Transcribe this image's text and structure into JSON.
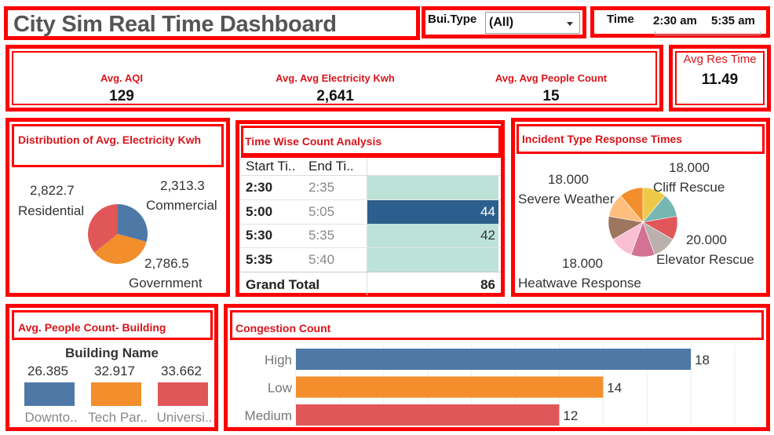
{
  "header": {
    "title": "City Sim Real Time Dashboard",
    "filter_label": "Bui.Type",
    "filter_value": "(All)",
    "time_label": "Time",
    "time_start": "2:30 am",
    "time_end": "5:35 am",
    "time_range_fraction": [
      0,
      1
    ]
  },
  "kpis": [
    {
      "label": "Avg. AQI",
      "value": "129"
    },
    {
      "label": "Avg. Avg Electricity Kwh",
      "value": "2,641"
    },
    {
      "label": "Avg. Avg People Count",
      "value": "15"
    }
  ],
  "res_time": {
    "label": "Avg Res Time",
    "value": "11.49"
  },
  "electricity": {
    "title": "Distribution of Avg. Electricity Kwh",
    "slices": [
      {
        "label": "Commercial",
        "value_text": "2,313.3",
        "value": 2313.3,
        "color": "#4e79a7"
      },
      {
        "label": "Government",
        "value_text": "2,786.5",
        "value": 2786.5,
        "color": "#f28e2b"
      },
      {
        "label": "Residential",
        "value_text": "2,822.7",
        "value": 2822.7,
        "color": "#e15759"
      }
    ]
  },
  "timewise": {
    "title": "Time Wise Count Analysis",
    "col_start": "Start Ti..",
    "col_end": "End Ti..",
    "rows": [
      {
        "start": "2:30",
        "end": "2:35",
        "value": "",
        "fill": "#bde3d8"
      },
      {
        "start": "5:00",
        "end": "5:05",
        "value": "44",
        "fill": "#2d5f8e"
      },
      {
        "start": "5:30",
        "end": "5:35",
        "value": "42",
        "fill": "#bde3d8"
      },
      {
        "start": "5:35",
        "end": "5:40",
        "value": "",
        "fill": "#bde3d8"
      }
    ],
    "total_label": "Grand Total",
    "total_value": "86"
  },
  "incidents": {
    "title": "Incident Type Response Times",
    "labels": [
      {
        "name": "Severe Weather",
        "value": "18.000"
      },
      {
        "name": "Cliff Rescue",
        "value": "18.000"
      },
      {
        "name": "Elevator Rescue",
        "value": "20.000"
      },
      {
        "name": "Heatwave Response",
        "value": "18.000"
      }
    ],
    "slice_colors": [
      "#edc948",
      "#76b7b2",
      "#e15759",
      "#bab0ac",
      "#d37295",
      "#fabfd2",
      "#9d7660",
      "#ffbe7d",
      "#f28e2b"
    ]
  },
  "people": {
    "title": "Avg. People Count- Building",
    "header": "Building Name",
    "bars": [
      {
        "name": "Downto..",
        "value_text": "26.385",
        "value": 26.385,
        "color": "#4e79a7"
      },
      {
        "name": "Tech Par..",
        "value_text": "32.917",
        "value": 32.917,
        "color": "#f28e2b"
      },
      {
        "name": "Universi..",
        "value_text": "33.662",
        "value": 33.662,
        "color": "#e15759"
      }
    ]
  },
  "chart_data": {
    "type": "bar",
    "title": "Congestion Count",
    "categories": [
      "High",
      "Low",
      "Medium"
    ],
    "values": [
      18,
      14,
      12
    ],
    "colors": [
      "#4e79a7",
      "#f28e2b",
      "#e15759"
    ],
    "xlim": [
      0,
      20
    ],
    "grid": true
  }
}
